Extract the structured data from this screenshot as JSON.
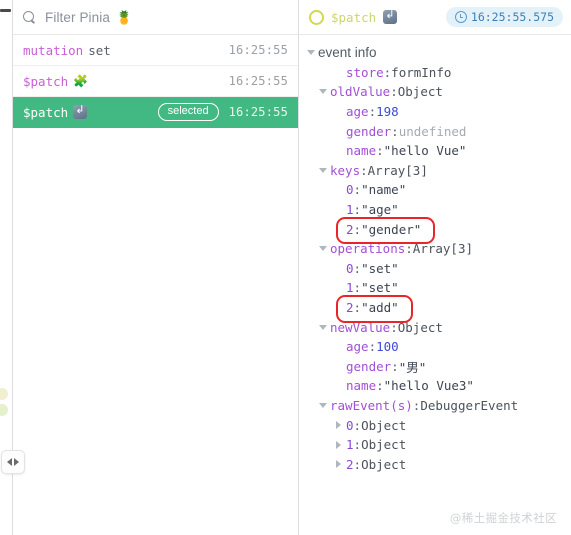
{
  "left_rail": {
    "toggle_name": "panel-collapse-toggle",
    "arrow_left": "◀",
    "arrow_right": "▶"
  },
  "filter": {
    "placeholder": "Filter Pinia",
    "emoji": "🍍",
    "icon": "search-icon"
  },
  "events": [
    {
      "type": "mutation",
      "name": "set",
      "emoji": "",
      "icon": "",
      "time": "16:25:55",
      "selected": false,
      "badge": ""
    },
    {
      "type": "$patch",
      "name": "",
      "emoji": "🧩",
      "icon": "",
      "time": "16:25:55",
      "selected": false,
      "badge": ""
    },
    {
      "type": "$patch",
      "name": "",
      "emoji": "",
      "icon": "patch-arrow-icon",
      "time": "16:25:55",
      "selected": true,
      "badge": "selected"
    }
  ],
  "detail": {
    "title": "$patch",
    "title_icon": "ring-icon",
    "patch_icon": "patch-arrow-icon",
    "timestamp": "16:25:55.575",
    "clock_icon": "clock-icon",
    "section": "event info",
    "nodes": [
      {
        "indent": 1,
        "caret": "none",
        "key": "store",
        "keyStyle": "k",
        "sep": ": ",
        "value": "formInfo",
        "valStyle": "v-type"
      },
      {
        "indent": 0,
        "caret": "down",
        "key": "oldValue",
        "keyStyle": "k",
        "sep": ": ",
        "value": "Object",
        "valStyle": "v-type"
      },
      {
        "indent": 1,
        "caret": "none",
        "key": "age",
        "keyStyle": "k",
        "sep": ": ",
        "value": "198",
        "valStyle": "v-num"
      },
      {
        "indent": 1,
        "caret": "none",
        "key": "gender",
        "keyStyle": "k",
        "sep": ": ",
        "value": "undefined",
        "valStyle": "v-undef"
      },
      {
        "indent": 1,
        "caret": "none",
        "key": "name",
        "keyStyle": "k",
        "sep": ": ",
        "value": "\"hello Vue\"",
        "valStyle": "v-str"
      },
      {
        "indent": 0,
        "caret": "down",
        "key": "keys",
        "keyStyle": "k",
        "sep": ": ",
        "value": "Array[3]",
        "valStyle": "v-type"
      },
      {
        "indent": 1,
        "caret": "none",
        "key": "0",
        "keyStyle": "idx",
        "sep": ": ",
        "value": "\"name\"",
        "valStyle": "v-str"
      },
      {
        "indent": 1,
        "caret": "none",
        "key": "1",
        "keyStyle": "idx",
        "sep": ": ",
        "value": "\"age\"",
        "valStyle": "v-str"
      },
      {
        "indent": 1,
        "caret": "none",
        "key": "2",
        "keyStyle": "idx",
        "sep": ": ",
        "value": "\"gender\"",
        "valStyle": "v-str",
        "highlight": true
      },
      {
        "indent": 0,
        "caret": "down",
        "key": "operations",
        "keyStyle": "k",
        "sep": ": ",
        "value": "Array[3]",
        "valStyle": "v-type"
      },
      {
        "indent": 1,
        "caret": "none",
        "key": "0",
        "keyStyle": "idx",
        "sep": ": ",
        "value": "\"set\"",
        "valStyle": "v-str"
      },
      {
        "indent": 1,
        "caret": "none",
        "key": "1",
        "keyStyle": "idx",
        "sep": ": ",
        "value": "\"set\"",
        "valStyle": "v-str"
      },
      {
        "indent": 1,
        "caret": "none",
        "key": "2",
        "keyStyle": "idx",
        "sep": ": ",
        "value": "\"add\"",
        "valStyle": "v-str",
        "highlight": true
      },
      {
        "indent": 0,
        "caret": "down",
        "key": "newValue",
        "keyStyle": "k",
        "sep": ": ",
        "value": "Object",
        "valStyle": "v-type"
      },
      {
        "indent": 1,
        "caret": "none",
        "key": "age",
        "keyStyle": "k",
        "sep": ": ",
        "value": "100",
        "valStyle": "v-num"
      },
      {
        "indent": 1,
        "caret": "none",
        "key": "gender",
        "keyStyle": "k",
        "sep": ": ",
        "value": "\"男\"",
        "valStyle": "v-str"
      },
      {
        "indent": 1,
        "caret": "none",
        "key": "name",
        "keyStyle": "k",
        "sep": ": ",
        "value": "\"hello Vue3\"",
        "valStyle": "v-str"
      },
      {
        "indent": 0,
        "caret": "down",
        "key": "rawEvent(s)",
        "keyStyle": "k",
        "sep": ": ",
        "value": "DebuggerEvent",
        "valStyle": "v-type"
      },
      {
        "indent": 1,
        "caret": "right",
        "key": "0",
        "keyStyle": "idx",
        "sep": ": ",
        "value": "Object",
        "valStyle": "v-type"
      },
      {
        "indent": 1,
        "caret": "right",
        "key": "1",
        "keyStyle": "idx",
        "sep": ": ",
        "value": "Object",
        "valStyle": "v-type"
      },
      {
        "indent": 1,
        "caret": "right",
        "key": "2",
        "keyStyle": "idx",
        "sep": ": ",
        "value": "Object",
        "valStyle": "v-type"
      }
    ]
  },
  "watermark": "@稀土掘金技术社区",
  "colors": {
    "selected_row": "#42b983",
    "highlight_box": "#e8262a",
    "time_pill_bg": "#e3f2f9",
    "time_pill_text": "#3f7fb5",
    "key_purple": "#a24fd6",
    "number_blue": "#3c4ad6"
  }
}
